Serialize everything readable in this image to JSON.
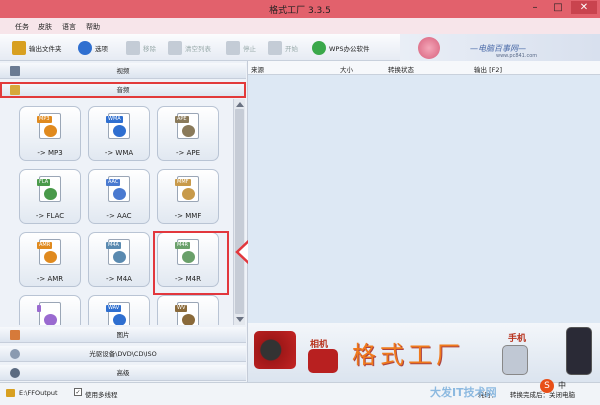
{
  "window": {
    "title": "格式工厂 3.3.5",
    "minimize": "–",
    "maximize": "□",
    "close": "✕"
  },
  "menu": [
    "任务",
    "皮肤",
    "语言",
    "帮助"
  ],
  "toolbar": {
    "buttons": [
      {
        "label": "输出文件夹",
        "color": "#d8a021"
      },
      {
        "label": "选项",
        "color": "#2f6fd0"
      },
      {
        "label": "移除",
        "color": "#9aa6b6"
      },
      {
        "label": "清空列表",
        "color": "#9aa6b6"
      },
      {
        "label": "停止",
        "color": "#9aa6b6"
      },
      {
        "label": "开始",
        "color": "#9aa6b6"
      },
      {
        "label": "WPS办公软件",
        "color": "#3aa84a"
      }
    ],
    "brand_text": "—电脑百事网—",
    "brand_url": "www.pc841.com"
  },
  "sections": {
    "video": "视频",
    "audio": "音频",
    "picture": "图片",
    "disc": "光驱设备\\DVD\\CD\\ISO",
    "advanced": "高级"
  },
  "formats": [
    {
      "tag": "MP3",
      "label": "-> MP3",
      "color": "#e08a1e"
    },
    {
      "tag": "WMA",
      "label": "-> WMA",
      "color": "#2f6fd0"
    },
    {
      "tag": "APE",
      "label": "-> APE",
      "color": "#8a7a5a"
    },
    {
      "tag": "FLA",
      "label": "-> FLAC",
      "color": "#4a9a4a"
    },
    {
      "tag": "AAC",
      "label": "-> AAC",
      "color": "#4a7ad0"
    },
    {
      "tag": "MMF",
      "label": "-> MMF",
      "color": "#c89a4a"
    },
    {
      "tag": "AMR",
      "label": "-> AMR",
      "color": "#e08a1e"
    },
    {
      "tag": "M4A",
      "label": "-> M4A",
      "color": "#5a8ab0"
    },
    {
      "tag": "M4R",
      "label": "-> M4R",
      "color": "#6aa06a"
    },
    {
      "tag": "",
      "label": "",
      "color": "#9a6ad0"
    },
    {
      "tag": "WAV",
      "label": "",
      "color": "#2f6fd0"
    },
    {
      "tag": "WV",
      "label": "",
      "color": "#8a6a3a"
    }
  ],
  "table": {
    "headers": [
      "来源",
      "大小",
      "转换状态",
      "输出 [F2]"
    ]
  },
  "banner": {
    "main": "格式工厂",
    "camera": "相机",
    "phone": "手机"
  },
  "status": {
    "output_path": "E:\\FFOutput",
    "multithread": "使用多线程",
    "elapsed": "耗时：",
    "done": "转换完成后：关闭电脑"
  },
  "watermark": {
    "text": "大发IT技术网",
    "s": "S",
    "zh": "中"
  }
}
